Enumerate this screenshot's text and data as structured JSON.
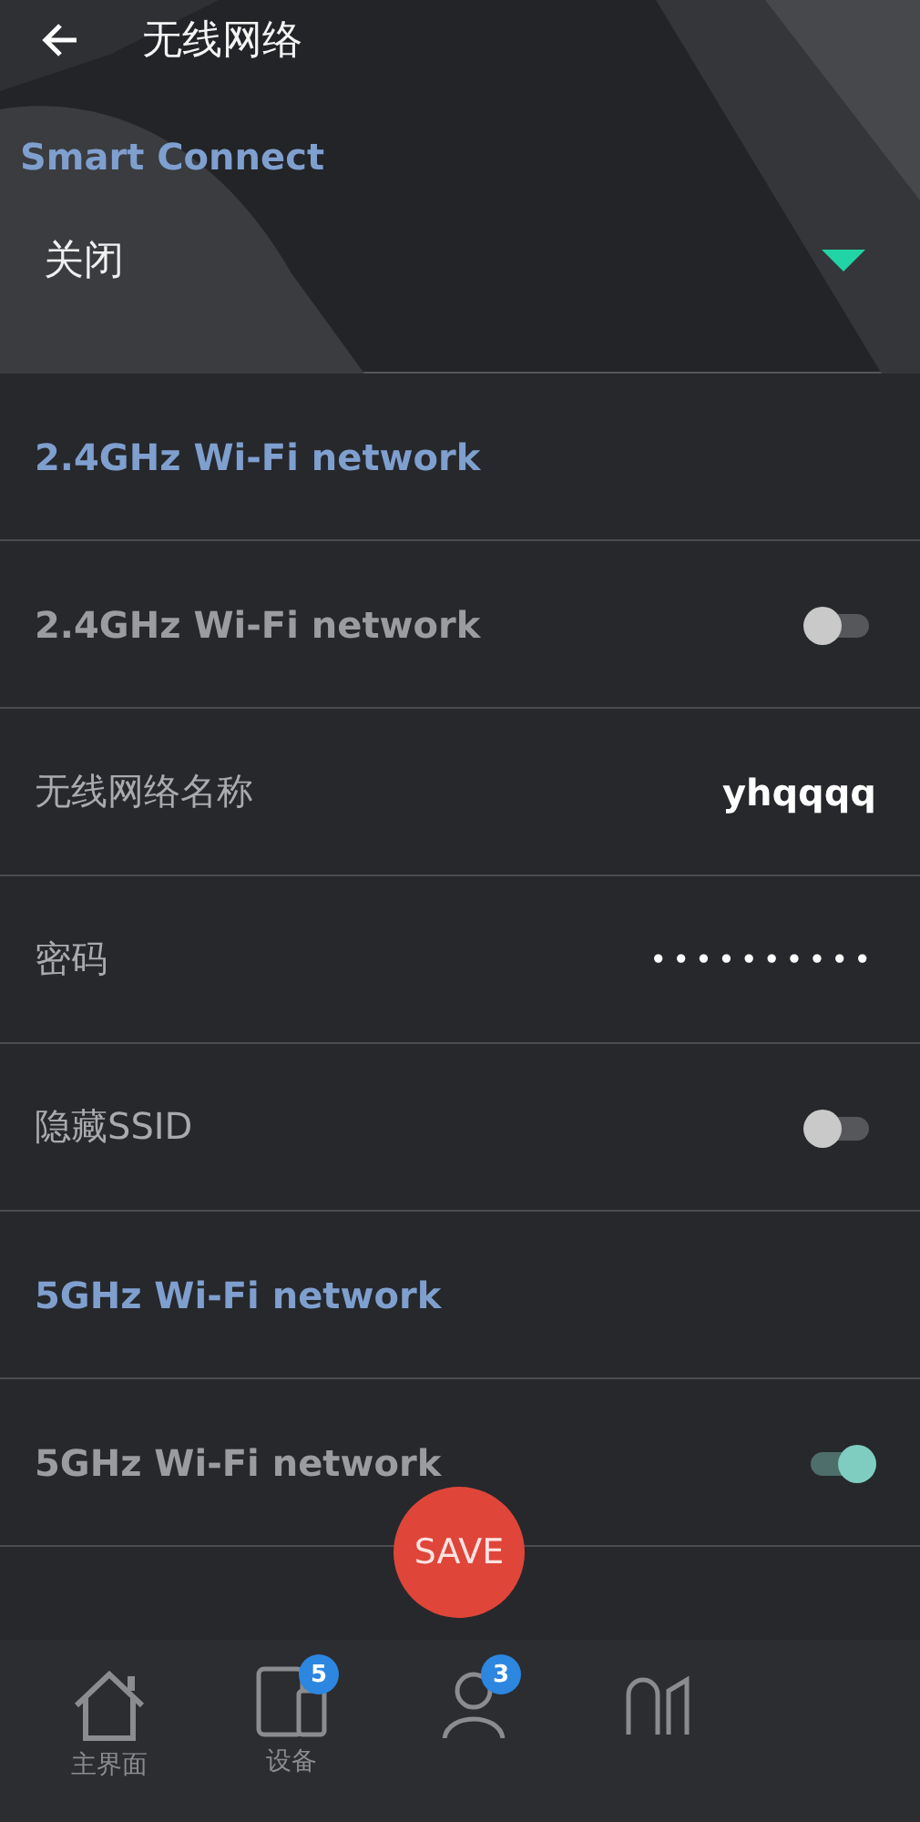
{
  "header": {
    "title": "无线网络"
  },
  "smart_connect": {
    "label": "Smart Connect",
    "value": "关闭"
  },
  "rows": [
    {
      "kind": "section",
      "label": "2.4GHz Wi-Fi network"
    },
    {
      "kind": "toggle",
      "label": "2.4GHz Wi-Fi network",
      "on": false
    },
    {
      "kind": "value",
      "label": "无线网络名称",
      "value": "yhqqqq"
    },
    {
      "kind": "password",
      "label": "密码",
      "value": "••••••••••"
    },
    {
      "kind": "toggle",
      "label": "隐藏SSID",
      "on": false
    },
    {
      "kind": "section",
      "label": "5GHz Wi-Fi network"
    },
    {
      "kind": "toggle",
      "label": "5GHz Wi-Fi network",
      "on": true
    }
  ],
  "save_button": "SAVE",
  "nav": [
    {
      "kind": "home",
      "label": "主界面"
    },
    {
      "kind": "devices",
      "label": "设备",
      "badge": "5"
    },
    {
      "kind": "user",
      "badge": "3"
    },
    {
      "kind": "tools"
    }
  ]
}
